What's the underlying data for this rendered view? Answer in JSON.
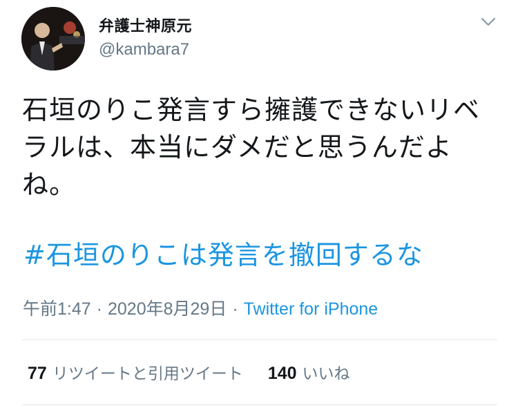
{
  "user": {
    "display_name": "弁護士神原元",
    "handle": "@kambara7"
  },
  "tweet": {
    "text": "石垣のりこ発言すら擁護できないリベラルは、本当にダメだと思うんだよね。",
    "hashtag": "#石垣のりこは発言を撤回するな",
    "time": "午前1:47",
    "date": "2020年8月29日",
    "separator": "·",
    "source": "Twitter for iPhone"
  },
  "stats": {
    "retweets_count": "77",
    "retweets_label": "リツイートと引用ツイート",
    "likes_count": "140",
    "likes_label": "いいね"
  },
  "icons": {
    "caret": "chevron-down-icon",
    "avatar": "profile-photo"
  },
  "colors": {
    "link": "#1b95e0",
    "secondary_text": "#657786",
    "primary_text": "#14171a",
    "divider": "#e1e8ed"
  }
}
